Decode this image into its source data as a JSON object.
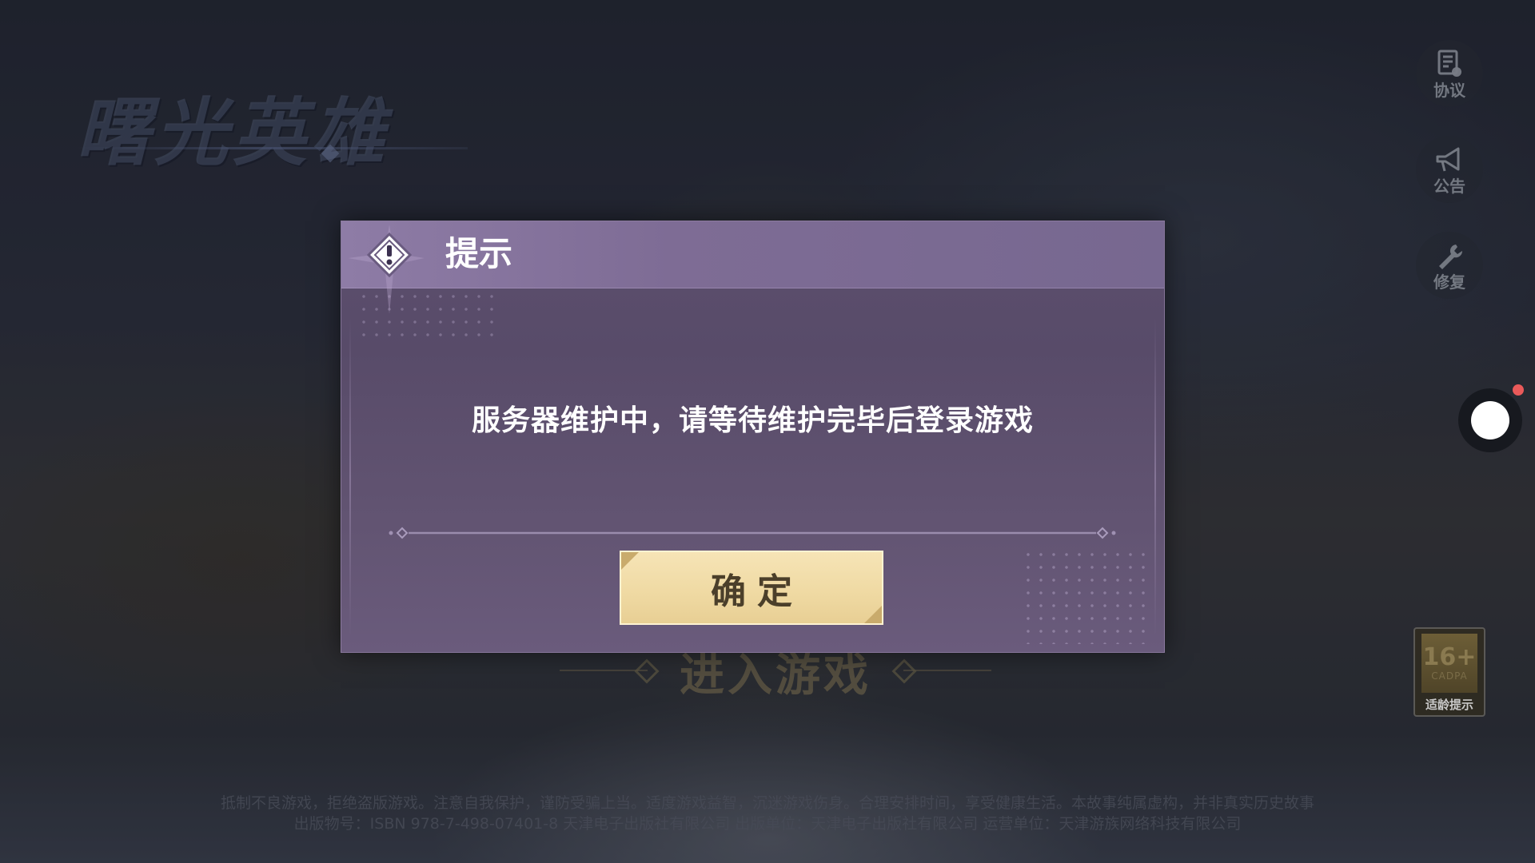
{
  "background": {
    "logo_text": "曙光英雄",
    "enter_game_label": "进入游戏",
    "footer_lines": [
      "抵制不良游戏，拒绝盗版游戏。注意自我保护，谨防受骗上当。适度游戏益智，沉迷游戏伤身。合理安排时间，享受健康生活。本故事纯属虚构，并非真实历史故事",
      "出版物号：ISBN 978-7-498-07401-8 天津电子出版社有限公司 出版单位：天津电子出版社有限公司 运营单位：天津游族网络科技有限公司"
    ]
  },
  "side_buttons": [
    {
      "label": "协议",
      "icon": "agreement-icon"
    },
    {
      "label": "公告",
      "icon": "megaphone-icon"
    },
    {
      "label": "修复",
      "icon": "wrench-icon"
    }
  ],
  "age_rating": {
    "number": "16+",
    "org": "CADPA",
    "label": "适龄提示"
  },
  "dialog": {
    "title": "提示",
    "message": "服务器维护中，请等待维护完毕后登录游戏",
    "confirm_label": "确定"
  },
  "colors": {
    "dialog_header": "#8e7ca6",
    "dialog_body": "#5c4f6e",
    "confirm_button": "#f3e0ae",
    "notification_badge": "#ea5a5a"
  }
}
